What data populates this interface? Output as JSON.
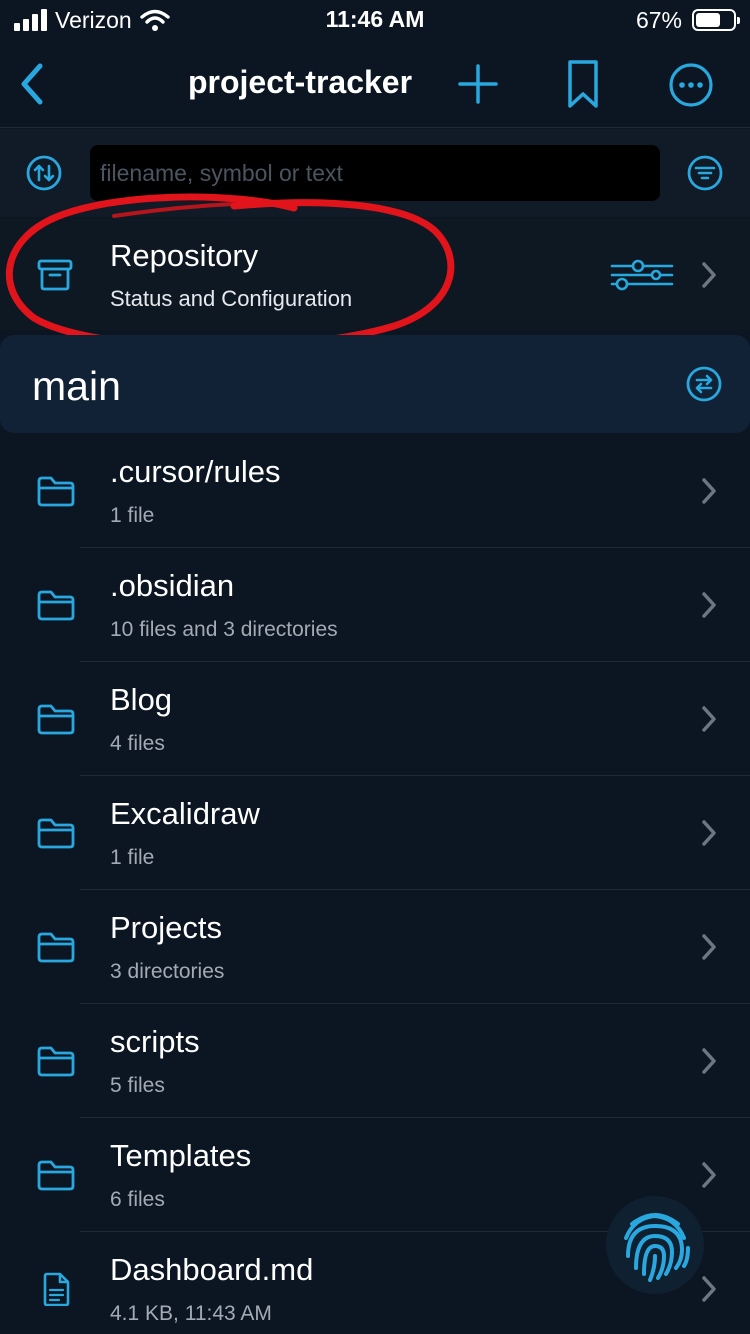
{
  "status_bar": {
    "carrier": "Verizon",
    "time": "11:46 AM",
    "battery_percent": "67%",
    "battery_level": 0.67
  },
  "nav": {
    "title": "project-tracker",
    "icons": [
      "chevron-left-icon",
      "plus-icon",
      "bookmark-icon",
      "ellipsis-circle-icon"
    ]
  },
  "search": {
    "placeholder": "filename, symbol or text",
    "value": ""
  },
  "repository": {
    "title": "Repository",
    "subtitle": "Status and Configuration"
  },
  "branch": {
    "name": "main"
  },
  "files": [
    {
      "name": ".cursor/rules",
      "meta": "1 file",
      "type": "folder"
    },
    {
      "name": ".obsidian",
      "meta": "10 files and 3 directories",
      "type": "folder"
    },
    {
      "name": "Blog",
      "meta": "4 files",
      "type": "folder"
    },
    {
      "name": "Excalidraw",
      "meta": "1 file",
      "type": "folder"
    },
    {
      "name": "Projects",
      "meta": "3 directories",
      "type": "folder"
    },
    {
      "name": "scripts",
      "meta": "5 files",
      "type": "folder"
    },
    {
      "name": "Templates",
      "meta": "6 files",
      "type": "folder"
    },
    {
      "name": "Dashboard.md",
      "meta": "4.1 KB, 11:43 AM",
      "type": "file"
    }
  ],
  "colors": {
    "background": "#0b1622",
    "accent": "#29a8e0",
    "annotation": "#e0141a",
    "secondary_text": "#a3aab3"
  }
}
